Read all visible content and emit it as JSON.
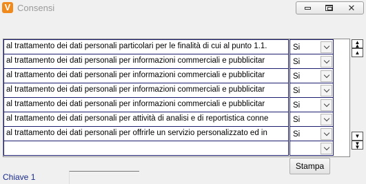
{
  "window": {
    "app_icon_letter": "V",
    "title": "Consensi",
    "minimize_glyph": "",
    "close_glyph": "✕"
  },
  "rows": [
    {
      "text": "al trattamento dei dati personali particolari per le finalità di cui al punto 1.1.",
      "value": "Si"
    },
    {
      "text": "al trattamento dei dati personali per informazioni commerciali e pubblicitar",
      "value": "Si"
    },
    {
      "text": "al trattamento dei dati personali per informazioni commerciali e pubblicitar",
      "value": "Si"
    },
    {
      "text": "al trattamento dei dati personali per informazioni commerciali e pubblicitar",
      "value": "Si"
    },
    {
      "text": "al trattamento dei dati personali per informazioni commerciali e pubblicitar",
      "value": "Si"
    },
    {
      "text": "al trattamento dei dati personali per attività di analisi e di reportistica conne",
      "value": "Si"
    },
    {
      "text": "al trattamento dei dati personali per offrirle un servizio personalizzato ed in",
      "value": "Si"
    },
    {
      "text": "",
      "value": ""
    }
  ],
  "buttons": {
    "stampa": "Stampa"
  },
  "footer": {
    "chiave_label": "Chiave 1",
    "chiave_value": ""
  },
  "colors": {
    "accent_icon": "#f08a1c",
    "label_blue": "#1a2a8c",
    "cell_border": "#1a1a6e"
  },
  "icons": [
    "app-icon",
    "minimize-icon",
    "maximize-icon",
    "close-icon",
    "dropdown-arrow-icon",
    "scroll-top-icon",
    "scroll-up-icon",
    "scroll-down-icon",
    "scroll-bottom-icon"
  ]
}
